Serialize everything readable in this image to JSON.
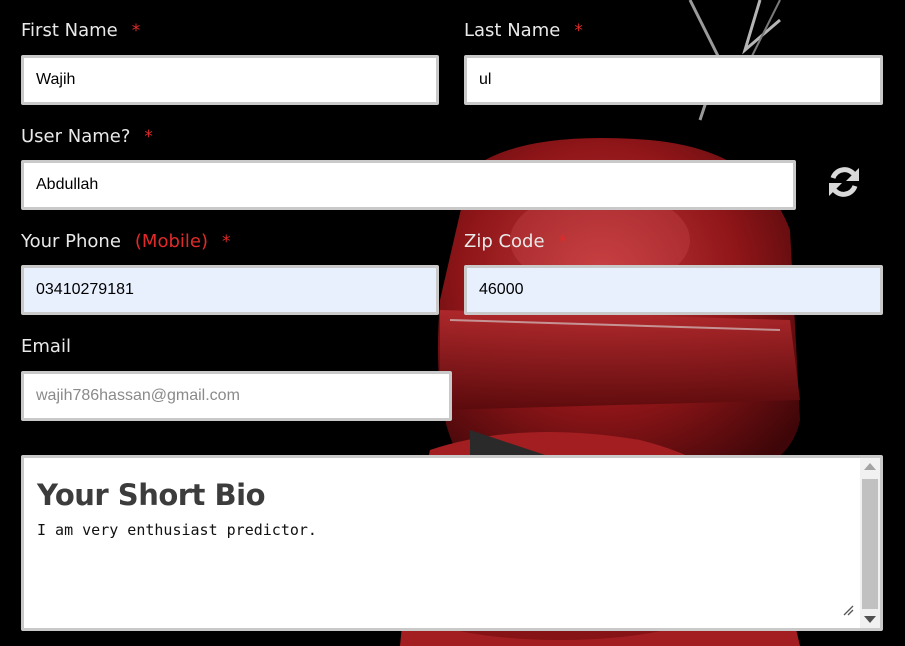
{
  "first_name": {
    "label": "First Name",
    "required": "*",
    "value": "Wajih"
  },
  "last_name": {
    "label": "Last Name",
    "required": "*",
    "value": "ul"
  },
  "user_name": {
    "label": "User Name?",
    "required": "*",
    "value": "Abdullah",
    "refresh_icon": "refresh-icon"
  },
  "phone": {
    "label": "Your Phone",
    "note": "(Mobile)",
    "required": "*",
    "value": "03410279181"
  },
  "zip": {
    "label": "Zip Code",
    "required": "*",
    "value": "46000"
  },
  "email": {
    "label": "Email",
    "placeholder": "wajih786hassan@gmail.com"
  },
  "bio": {
    "title": "Your Short Bio",
    "text": "I am very enthusiast predictor."
  },
  "colors": {
    "required": "#e02a2a",
    "label": "#e9e9e9",
    "autofill_bg": "#e8f0fe",
    "glove_red": "#9d1a1c"
  }
}
